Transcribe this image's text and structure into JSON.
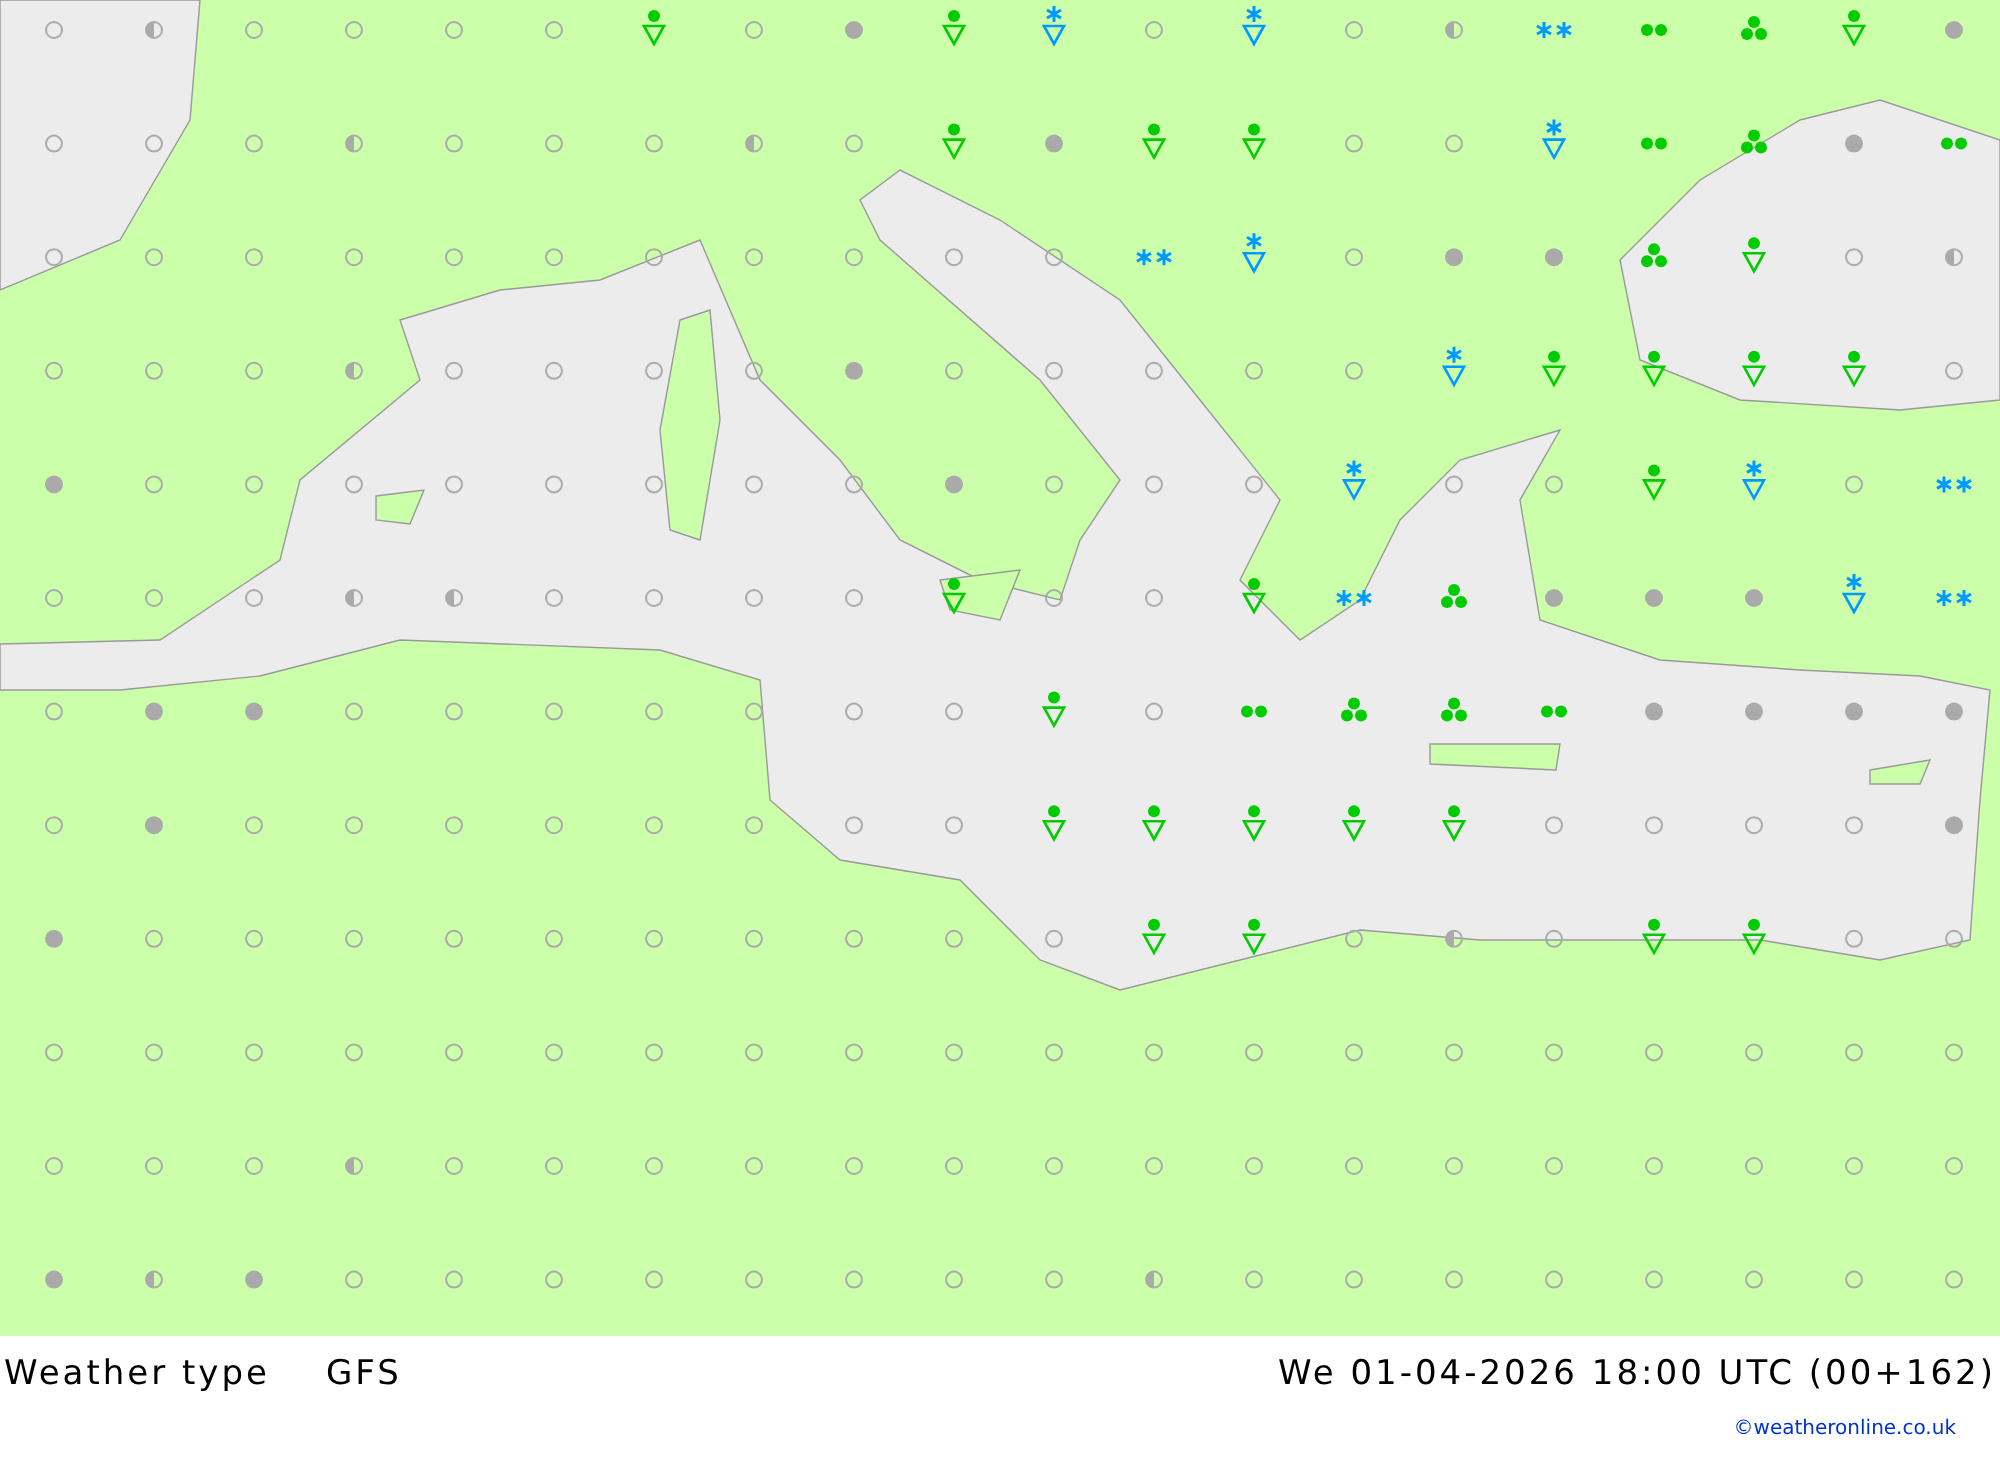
{
  "map": {
    "grid": [
      [
        {
          "kind": "clear"
        },
        {
          "kind": "partly"
        },
        {
          "kind": "clear"
        },
        {
          "kind": "clear"
        },
        {
          "kind": "clear"
        },
        {
          "kind": "clear"
        },
        {
          "kind": "shower"
        },
        {
          "kind": "clear"
        },
        {
          "kind": "cloudy"
        },
        {
          "kind": "shower"
        },
        {
          "kind": "snowshower"
        },
        {
          "kind": "clear"
        },
        {
          "kind": "snowshower"
        },
        {
          "kind": "clear"
        },
        {
          "kind": "partly"
        },
        {
          "kind": "snow"
        },
        {
          "kind": "rain"
        },
        {
          "kind": "heavy"
        },
        {
          "kind": "shower"
        },
        {
          "kind": "cloudy"
        }
      ],
      [
        {
          "kind": "clear"
        },
        {
          "kind": "clear"
        },
        {
          "kind": "clear"
        },
        {
          "kind": "partly"
        },
        {
          "kind": "clear"
        },
        {
          "kind": "clear"
        },
        {
          "kind": "clear"
        },
        {
          "kind": "partly"
        },
        {
          "kind": "clear"
        },
        {
          "kind": "shower"
        },
        {
          "kind": "cloudy"
        },
        {
          "kind": "shower"
        },
        {
          "kind": "shower"
        },
        {
          "kind": "clear"
        },
        {
          "kind": "clear"
        },
        {
          "kind": "snowshower"
        },
        {
          "kind": "rain"
        },
        {
          "kind": "heavy"
        },
        {
          "kind": "cloudy"
        },
        {
          "kind": "rain"
        }
      ],
      [
        {
          "kind": "clear"
        },
        {
          "kind": "clear"
        },
        {
          "kind": "clear"
        },
        {
          "kind": "clear"
        },
        {
          "kind": "clear"
        },
        {
          "kind": "clear"
        },
        {
          "kind": "clear"
        },
        {
          "kind": "clear"
        },
        {
          "kind": "clear"
        },
        {
          "kind": "clear"
        },
        {
          "kind": "clear"
        },
        {
          "kind": "snow"
        },
        {
          "kind": "snowshower"
        },
        {
          "kind": "clear"
        },
        {
          "kind": "cloudy"
        },
        {
          "kind": "cloudy"
        },
        {
          "kind": "heavy"
        },
        {
          "kind": "shower"
        },
        {
          "kind": "clear"
        },
        {
          "kind": "partly"
        }
      ],
      [
        {
          "kind": "clear"
        },
        {
          "kind": "clear"
        },
        {
          "kind": "clear"
        },
        {
          "kind": "partly"
        },
        {
          "kind": "clear"
        },
        {
          "kind": "clear"
        },
        {
          "kind": "clear"
        },
        {
          "kind": "clear"
        },
        {
          "kind": "cloudy"
        },
        {
          "kind": "clear"
        },
        {
          "kind": "clear"
        },
        {
          "kind": "clear"
        },
        {
          "kind": "clear"
        },
        {
          "kind": "clear"
        },
        {
          "kind": "snowshower"
        },
        {
          "kind": "shower"
        },
        {
          "kind": "shower"
        },
        {
          "kind": "shower"
        },
        {
          "kind": "shower"
        },
        {
          "kind": "clear"
        }
      ],
      [
        {
          "kind": "cloudy"
        },
        {
          "kind": "clear"
        },
        {
          "kind": "clear"
        },
        {
          "kind": "clear"
        },
        {
          "kind": "clear"
        },
        {
          "kind": "clear"
        },
        {
          "kind": "clear"
        },
        {
          "kind": "clear"
        },
        {
          "kind": "clear"
        },
        {
          "kind": "cloudy"
        },
        {
          "kind": "clear"
        },
        {
          "kind": "clear"
        },
        {
          "kind": "clear"
        },
        {
          "kind": "snowshower"
        },
        {
          "kind": "clear"
        },
        {
          "kind": "clear"
        },
        {
          "kind": "shower"
        },
        {
          "kind": "snowshower"
        },
        {
          "kind": "clear"
        },
        {
          "kind": "snow"
        }
      ],
      [
        {
          "kind": "clear"
        },
        {
          "kind": "clear"
        },
        {
          "kind": "clear"
        },
        {
          "kind": "partly"
        },
        {
          "kind": "partly"
        },
        {
          "kind": "clear"
        },
        {
          "kind": "clear"
        },
        {
          "kind": "clear"
        },
        {
          "kind": "clear"
        },
        {
          "kind": "shower"
        },
        {
          "kind": "clear"
        },
        {
          "kind": "clear"
        },
        {
          "kind": "shower"
        },
        {
          "kind": "snow"
        },
        {
          "kind": "heavy"
        },
        {
          "kind": "cloudy"
        },
        {
          "kind": "cloudy"
        },
        {
          "kind": "cloudy"
        },
        {
          "kind": "snowshower"
        },
        {
          "kind": "snow"
        }
      ],
      [
        {
          "kind": "clear"
        },
        {
          "kind": "cloudy"
        },
        {
          "kind": "cloudy"
        },
        {
          "kind": "clear"
        },
        {
          "kind": "clear"
        },
        {
          "kind": "clear"
        },
        {
          "kind": "clear"
        },
        {
          "kind": "clear"
        },
        {
          "kind": "clear"
        },
        {
          "kind": "clear"
        },
        {
          "kind": "shower"
        },
        {
          "kind": "clear"
        },
        {
          "kind": "rain"
        },
        {
          "kind": "heavy"
        },
        {
          "kind": "heavy"
        },
        {
          "kind": "rain"
        },
        {
          "kind": "cloudy"
        },
        {
          "kind": "cloudy"
        },
        {
          "kind": "cloudy"
        },
        {
          "kind": "cloudy"
        }
      ],
      [
        {
          "kind": "clear"
        },
        {
          "kind": "cloudy"
        },
        {
          "kind": "clear"
        },
        {
          "kind": "clear"
        },
        {
          "kind": "clear"
        },
        {
          "kind": "clear"
        },
        {
          "kind": "clear"
        },
        {
          "kind": "clear"
        },
        {
          "kind": "clear"
        },
        {
          "kind": "clear"
        },
        {
          "kind": "shower"
        },
        {
          "kind": "shower"
        },
        {
          "kind": "shower"
        },
        {
          "kind": "shower"
        },
        {
          "kind": "shower"
        },
        {
          "kind": "clear"
        },
        {
          "kind": "clear"
        },
        {
          "kind": "clear"
        },
        {
          "kind": "clear"
        },
        {
          "kind": "cloudy"
        }
      ],
      [
        {
          "kind": "cloudy"
        },
        {
          "kind": "clear"
        },
        {
          "kind": "clear"
        },
        {
          "kind": "clear"
        },
        {
          "kind": "clear"
        },
        {
          "kind": "clear"
        },
        {
          "kind": "clear"
        },
        {
          "kind": "clear"
        },
        {
          "kind": "clear"
        },
        {
          "kind": "clear"
        },
        {
          "kind": "clear"
        },
        {
          "kind": "shower"
        },
        {
          "kind": "shower"
        },
        {
          "kind": "clear"
        },
        {
          "kind": "partly"
        },
        {
          "kind": "clear"
        },
        {
          "kind": "shower"
        },
        {
          "kind": "shower"
        },
        {
          "kind": "clear"
        },
        {
          "kind": "clear"
        }
      ],
      [
        {
          "kind": "clear"
        },
        {
          "kind": "clear"
        },
        {
          "kind": "clear"
        },
        {
          "kind": "clear"
        },
        {
          "kind": "clear"
        },
        {
          "kind": "clear"
        },
        {
          "kind": "clear"
        },
        {
          "kind": "clear"
        },
        {
          "kind": "clear"
        },
        {
          "kind": "clear"
        },
        {
          "kind": "clear"
        },
        {
          "kind": "clear"
        },
        {
          "kind": "clear"
        },
        {
          "kind": "clear"
        },
        {
          "kind": "clear"
        },
        {
          "kind": "clear"
        },
        {
          "kind": "clear"
        },
        {
          "kind": "clear"
        },
        {
          "kind": "clear"
        },
        {
          "kind": "clear"
        }
      ],
      [
        {
          "kind": "clear"
        },
        {
          "kind": "clear"
        },
        {
          "kind": "clear"
        },
        {
          "kind": "partly"
        },
        {
          "kind": "clear"
        },
        {
          "kind": "clear"
        },
        {
          "kind": "clear"
        },
        {
          "kind": "clear"
        },
        {
          "kind": "clear"
        },
        {
          "kind": "clear"
        },
        {
          "kind": "clear"
        },
        {
          "kind": "clear"
        },
        {
          "kind": "clear"
        },
        {
          "kind": "clear"
        },
        {
          "kind": "clear"
        },
        {
          "kind": "clear"
        },
        {
          "kind": "clear"
        },
        {
          "kind": "clear"
        },
        {
          "kind": "clear"
        },
        {
          "kind": "clear"
        }
      ],
      [
        {
          "kind": "cloudy"
        },
        {
          "kind": "partly"
        },
        {
          "kind": "cloudy"
        },
        {
          "kind": "clear"
        },
        {
          "kind": "clear"
        },
        {
          "kind": "clear"
        },
        {
          "kind": "clear"
        },
        {
          "kind": "clear"
        },
        {
          "kind": "clear"
        },
        {
          "kind": "clear"
        },
        {
          "kind": "clear"
        },
        {
          "kind": "partly"
        },
        {
          "kind": "clear"
        },
        {
          "kind": "clear"
        },
        {
          "kind": "clear"
        },
        {
          "kind": "clear"
        },
        {
          "kind": "clear"
        },
        {
          "kind": "clear"
        },
        {
          "kind": "clear"
        },
        {
          "kind": "clear"
        }
      ]
    ]
  },
  "footer": {
    "title": "Weather type",
    "model": "GFS",
    "time": "We 01-04-2026 18:00 UTC (00+162)",
    "credit": "©weatheronline.co.uk"
  }
}
